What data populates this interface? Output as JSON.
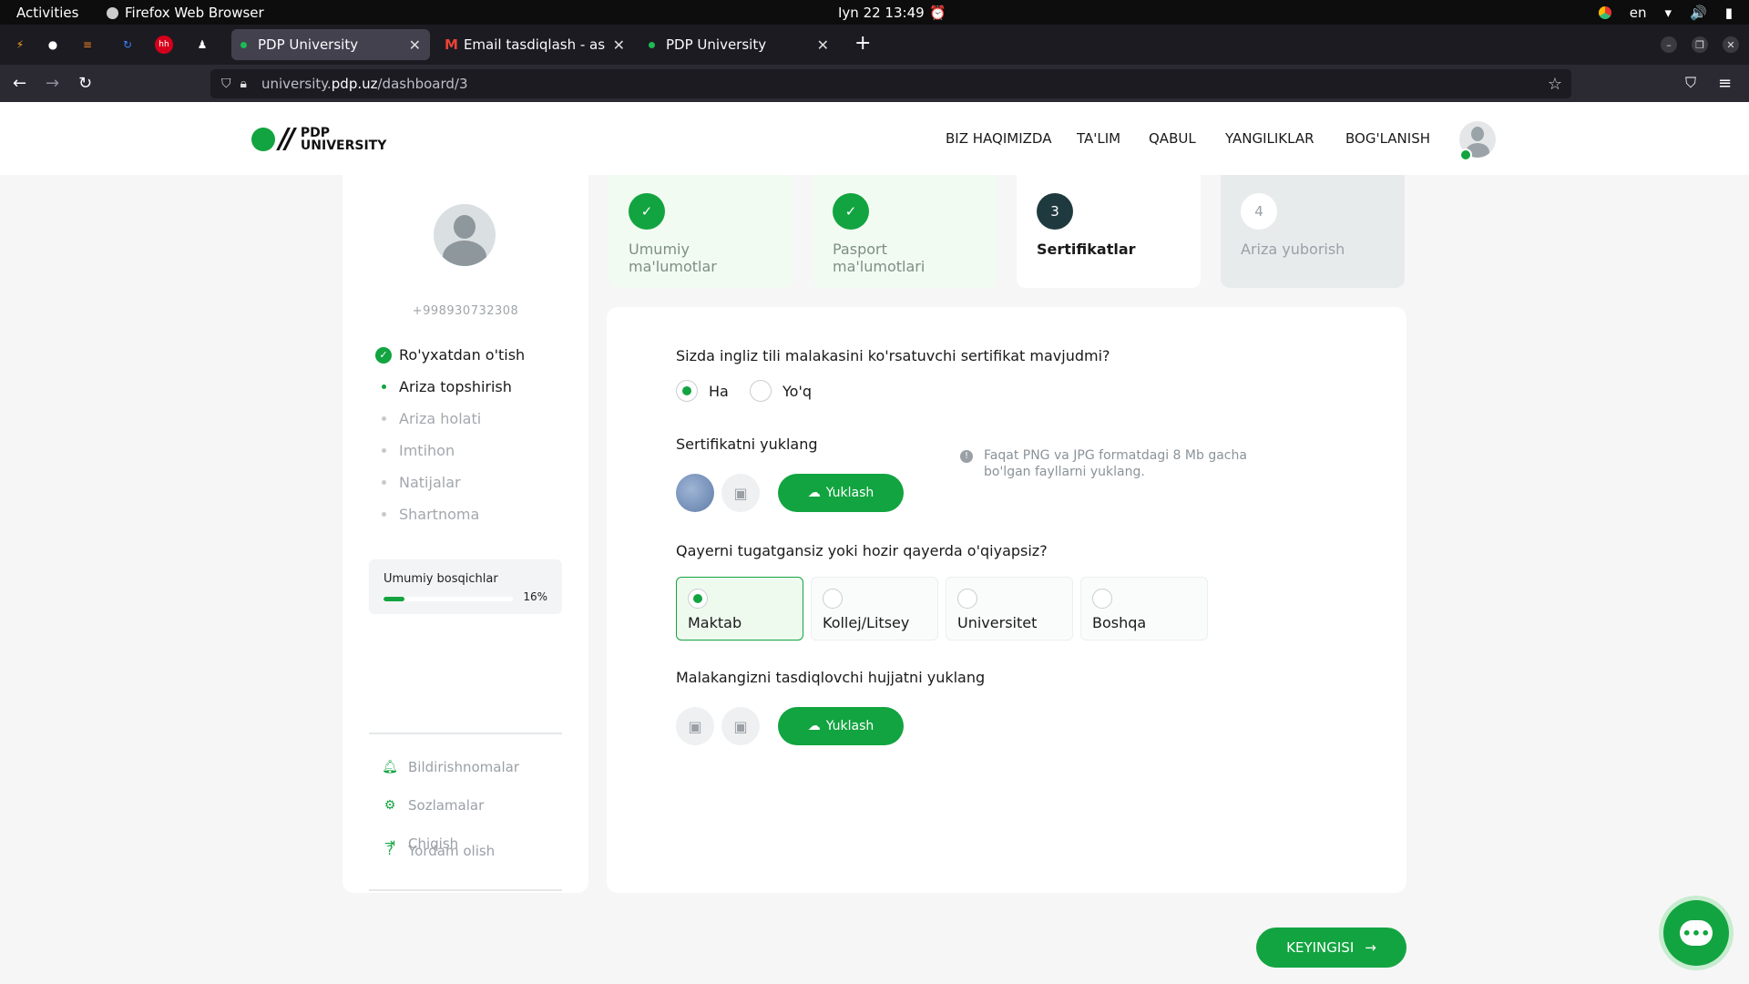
{
  "system": {
    "activities": "Activities",
    "app_name": "Firefox Web Browser",
    "clock": "Iyn 22  13:49",
    "lang": "en"
  },
  "tabs": [
    {
      "label": "PDP University",
      "active": true
    },
    {
      "label": "Email tasdiqlash - asadbe",
      "active": false
    },
    {
      "label": "PDP University",
      "active": false
    }
  ],
  "url": {
    "prefix": "university.",
    "domain": "pdp.uz",
    "path": "/dashboard/3"
  },
  "site": {
    "logo_line1": "PDP",
    "logo_line2": "UNIVERSITY",
    "menu": [
      "BIZ HAQIMIZDA",
      "TA'LIM",
      "QABUL",
      "YANGILIKLAR",
      "BOG'LANISH"
    ]
  },
  "sidebar": {
    "phone": "+998930732308",
    "steps": [
      {
        "label": "Ro'yxatdan o'tish",
        "state": "done"
      },
      {
        "label": "Ariza topshirish",
        "state": "current"
      },
      {
        "label": "Ariza holati",
        "state": "todo"
      },
      {
        "label": "Imtihon",
        "state": "todo"
      },
      {
        "label": "Natijalar",
        "state": "todo"
      },
      {
        "label": "Shartnoma",
        "state": "todo"
      }
    ],
    "progress_label": "Umumiy bosqichlar",
    "progress_value": "16%",
    "progress_fraction": 0.16,
    "links": [
      "Bildirishnomalar",
      "Sozlamalar",
      "Chiqish"
    ],
    "help": "Yordam olish"
  },
  "stepper": [
    {
      "number": "",
      "label": "Umumiy ma'lumotlar",
      "state": "done"
    },
    {
      "number": "",
      "label": "Pasport ma'lumotlari",
      "state": "done"
    },
    {
      "number": "3",
      "label": "Sertifikatlar",
      "state": "current"
    },
    {
      "number": "4",
      "label": "Ariza yuborish",
      "state": "todo"
    }
  ],
  "form": {
    "q1": "Sizda ingliz tili malakasini ko'rsatuvchi sertifikat mavjudmi?",
    "q1_yes": "Ha",
    "q1_no": "Yo'q",
    "q1_selected": "Ha",
    "upload1_label": "Sertifikatni yuklang",
    "upload_button": "Yuklash",
    "hint": "Faqat PNG va JPG formatdagi 8 Mb gacha bo'lgan fayllarni yuklang.",
    "q2": "Qayerni tugatgansiz yoki hozir qayerda o'qiyapsiz?",
    "q2_options": [
      "Maktab",
      "Kollej/Litsey",
      "Universitet",
      "Boshqa"
    ],
    "q2_selected": "Maktab",
    "upload2_label": "Malakangizni tasdiqlovchi hujjatni yuklang",
    "upload2_button": "Yuklash"
  },
  "next_button": "KEYINGISI",
  "colors": {
    "brand_green": "#12a440",
    "done_bg": "#f2fbf2",
    "todo_bg": "#e8ebec"
  }
}
